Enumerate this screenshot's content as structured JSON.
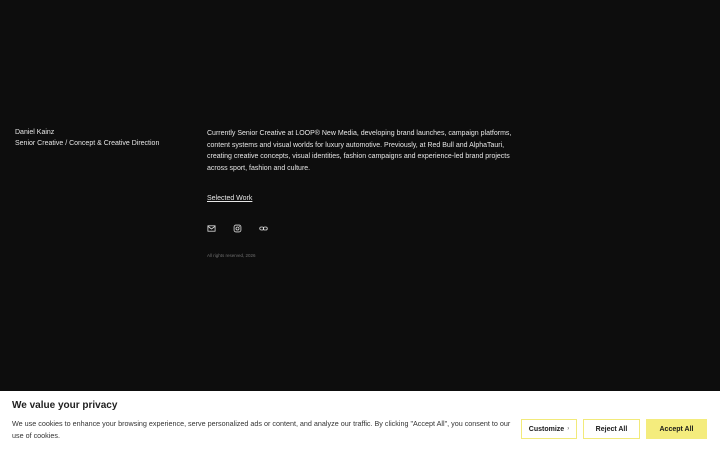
{
  "profile": {
    "name": "Daniel Kainz",
    "role": "Senior Creative / Concept & Creative Direction"
  },
  "bio": "Currently Senior Creative at LOOP® New Media, developing brand launches, campaign platforms, content systems and visual worlds for luxury automotive. Previously, at Red Bull and AlphaTauri, creating creative concepts, visual identities, fashion campaigns and experience-led brand projects across sport, fashion and culture.",
  "links": {
    "selected_work": "Selected Work"
  },
  "socials": [
    "mail-icon",
    "instagram-icon",
    "link-icon"
  ],
  "footer": {
    "rights": "All rights reserved, 2026"
  },
  "cookie": {
    "title": "We value your privacy",
    "message": "We use cookies to enhance your browsing experience, serve personalized ads or content, and analyze our traffic. By clicking \"Accept All\", you consent to our use of cookies.",
    "customize_label": "Customize",
    "reject_label": "Reject All",
    "accept_label": "Accept All",
    "accent_color": "#f4ec7d"
  }
}
